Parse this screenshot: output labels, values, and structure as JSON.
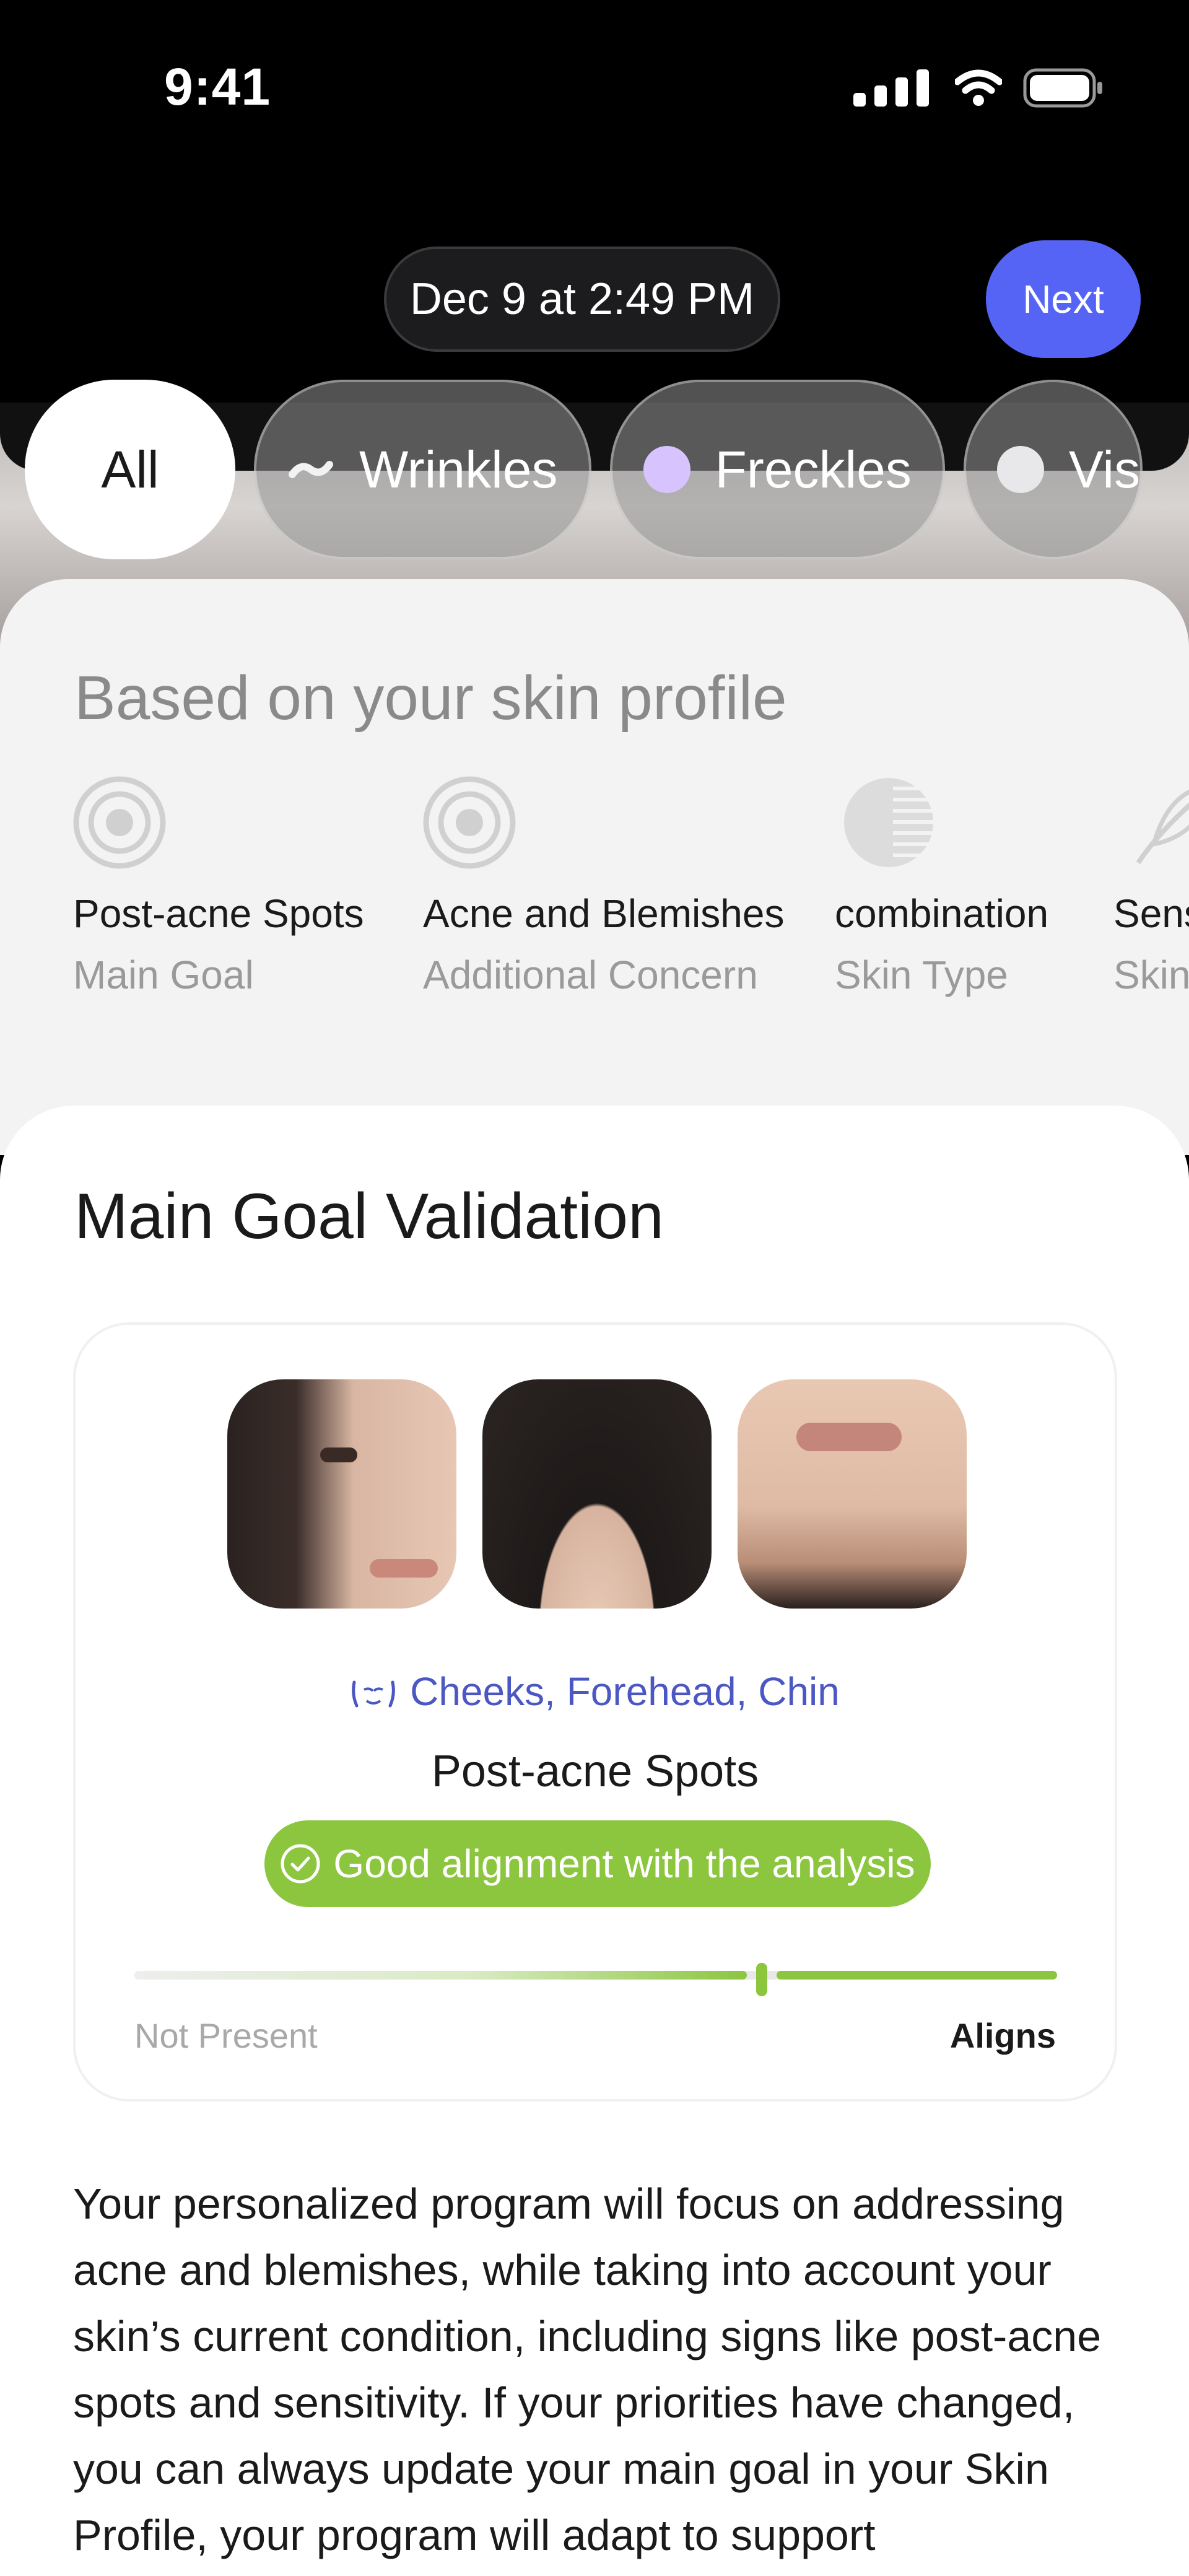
{
  "status_bar": {
    "time": "9:41"
  },
  "header": {
    "date": "Dec 9 at 2:49 PM",
    "next_label": "Next"
  },
  "filters": [
    {
      "label": "All",
      "selected": true
    },
    {
      "label": "Wrinkles",
      "icon": "wrinkle-icon"
    },
    {
      "label": "Freckles",
      "icon": "freckle-dot-icon",
      "color": "#d7c4ff"
    },
    {
      "label": "Vis",
      "icon": "spot-dot-icon",
      "color": "#e8e8ea"
    }
  ],
  "skin_profile": {
    "heading": "Based on your skin profile",
    "items": [
      {
        "title": "Post-acne Spots",
        "subtitle": "Main Goal",
        "icon": "target-icon"
      },
      {
        "title": "Acne and Blemishes",
        "subtitle": "Additional Concern",
        "icon": "target-icon"
      },
      {
        "title": "combination",
        "subtitle": "Skin Type",
        "icon": "half-circle-icon"
      },
      {
        "title": "Sens",
        "subtitle": "Skin",
        "icon": "feather-icon"
      }
    ]
  },
  "main_goal": {
    "title": "Main Goal Validation",
    "zones": "Cheeks, Forehead, Chin",
    "goal": "Post-acne Spots",
    "badge": "Good alignment with the analysis",
    "scale_min": "Not Present",
    "scale_max": "Aligns",
    "alignment_level": 0.68
  },
  "description": "Your personalized program will focus on addressing acne and blemishes, while taking into account your skin’s current condition, including signs like post-acne spots and sensitivity. If your priorities have changed, you can always update your main goal in your Skin Profile, your program will adapt to support",
  "colors": {
    "accent": "#5564f5",
    "success": "#8cc63f",
    "zone_text": "#4b57c2"
  }
}
